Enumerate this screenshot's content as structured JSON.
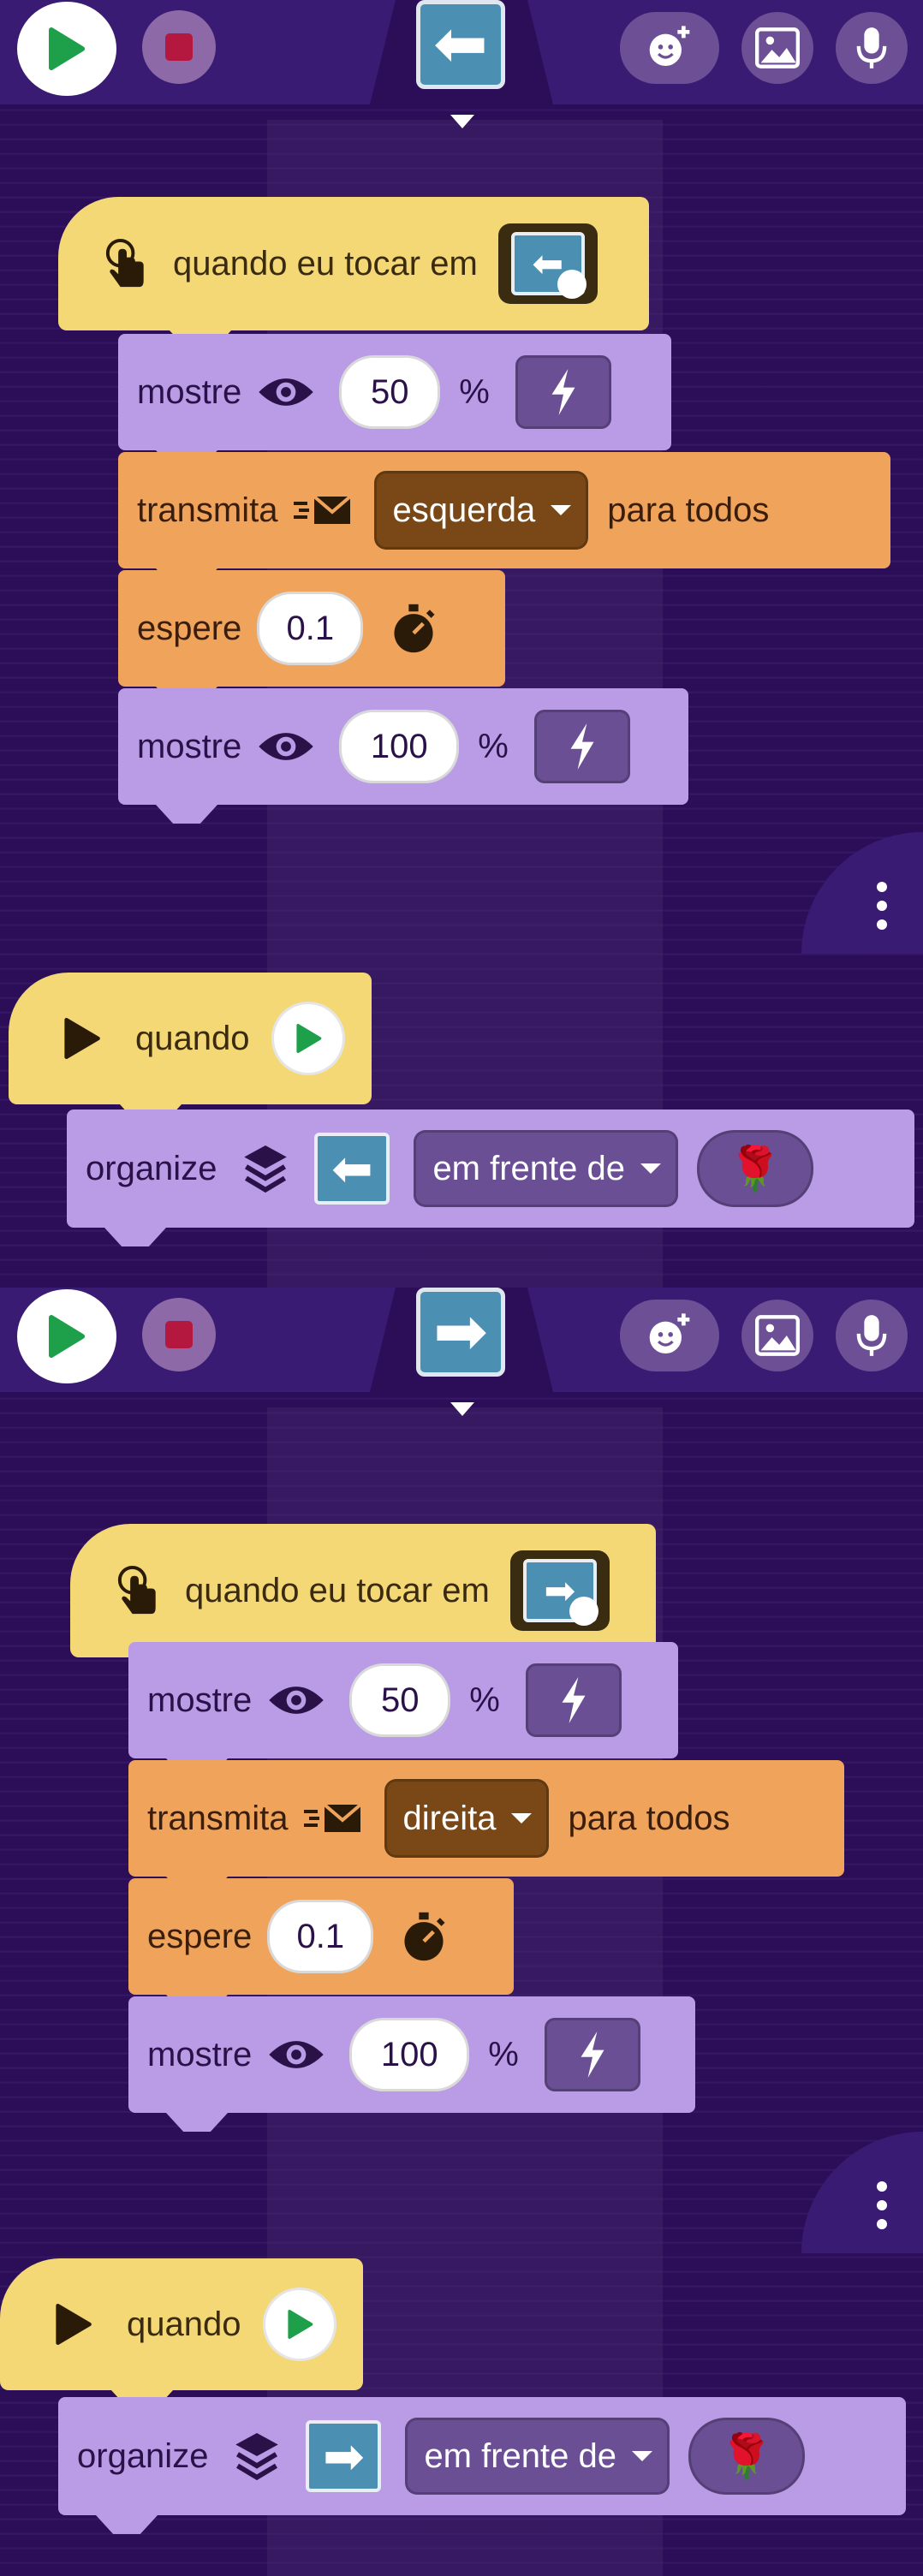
{
  "panels": [
    {
      "toolbar": {
        "go_label": "",
        "thumbnail_glyph": "⬅",
        "icons": [
          "green-flag-icon",
          "stop-icon",
          "add-character-icon",
          "image-icon",
          "microphone-icon"
        ]
      },
      "script1": {
        "hat_label": "quando eu tocar em",
        "hat_thumb_glyph": "⬅",
        "show1_label": "mostre",
        "show1_value": "50",
        "show1_pct": "%",
        "broadcast_label": "transmita",
        "broadcast_value": "esquerda",
        "broadcast_suffix": "para todos",
        "wait_label": "espere",
        "wait_value": "0.1",
        "show2_label": "mostre",
        "show2_value": "100",
        "show2_pct": "%"
      },
      "script2": {
        "hat_label": "quando",
        "arrange_label": "organize",
        "arrange_tile_glyph": "⬅",
        "arrange_value": "em frente de",
        "arrange_target_glyph": "🌹"
      }
    },
    {
      "toolbar": {
        "go_label": "",
        "thumbnail_glyph": "➡",
        "icons": [
          "green-flag-icon",
          "stop-icon",
          "add-character-icon",
          "image-icon",
          "microphone-icon"
        ]
      },
      "script1": {
        "hat_label": "quando eu tocar em",
        "hat_thumb_glyph": "➡",
        "show1_label": "mostre",
        "show1_value": "50",
        "show1_pct": "%",
        "broadcast_label": "transmita",
        "broadcast_value": "direita",
        "broadcast_suffix": "para todos",
        "wait_label": "espere",
        "wait_value": "0.1",
        "show2_label": "mostre",
        "show2_value": "100",
        "show2_pct": "%"
      },
      "script2": {
        "hat_label": "quando",
        "arrange_label": "organize",
        "arrange_tile_glyph": "➡",
        "arrange_value": "em frente de",
        "arrange_target_glyph": "🌹"
      }
    }
  ],
  "colors": {
    "background": "#2b0e57",
    "toolbar": "#3a1b74",
    "hat_block": "#f3d875",
    "looks_block": "#b99be6",
    "control_block": "#f0a35a",
    "stop_red": "#b4183e",
    "go_green": "#1ea04a"
  }
}
